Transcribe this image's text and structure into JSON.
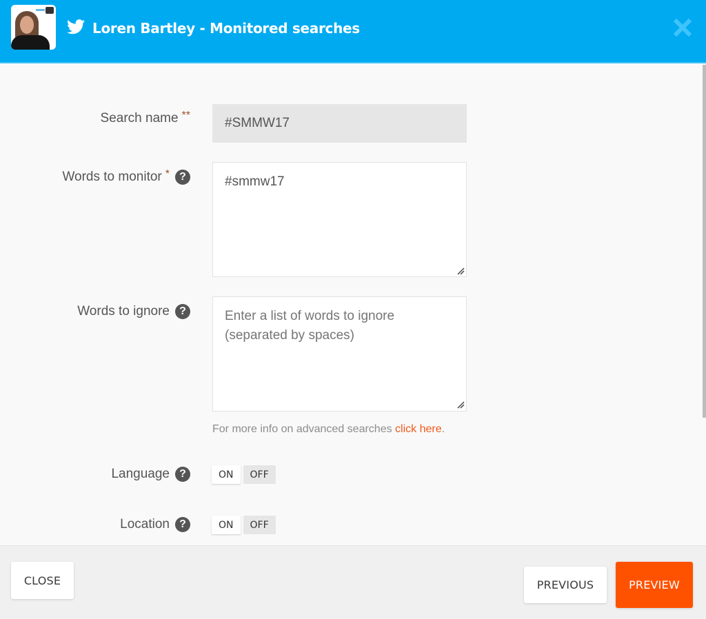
{
  "header": {
    "title": "Loren Bartley - Monitored searches",
    "avatar_alt": "Loren Bartley profile photo",
    "brand_color": "#00aaf0",
    "icons": {
      "brand": "twitter-bird-icon",
      "close": "close-x-icon"
    }
  },
  "form": {
    "search_name": {
      "label": "Search name",
      "required_marker": "**",
      "value": "#SMMW17"
    },
    "words_to_monitor": {
      "label": "Words to monitor",
      "required_marker": "*",
      "value": "#smmw17",
      "help_icon": "question-circle-icon"
    },
    "words_to_ignore": {
      "label": "Words to ignore",
      "value": "",
      "placeholder": "Enter a list of words to ignore (separated by spaces)",
      "help_icon": "question-circle-icon"
    },
    "advanced_info": {
      "text": "For more info on advanced searches ",
      "link_text": "click here",
      "suffix": "."
    },
    "language": {
      "label": "Language",
      "on_label": "ON",
      "off_label": "OFF",
      "selected": "OFF"
    },
    "location": {
      "label": "Location",
      "on_label": "ON",
      "off_label": "OFF",
      "selected": "OFF"
    },
    "help_glyph": "?"
  },
  "footer": {
    "close_label": "CLOSE",
    "previous_label": "PREVIOUS",
    "preview_label": "PREVIEW",
    "accent_color": "#ff5200"
  }
}
